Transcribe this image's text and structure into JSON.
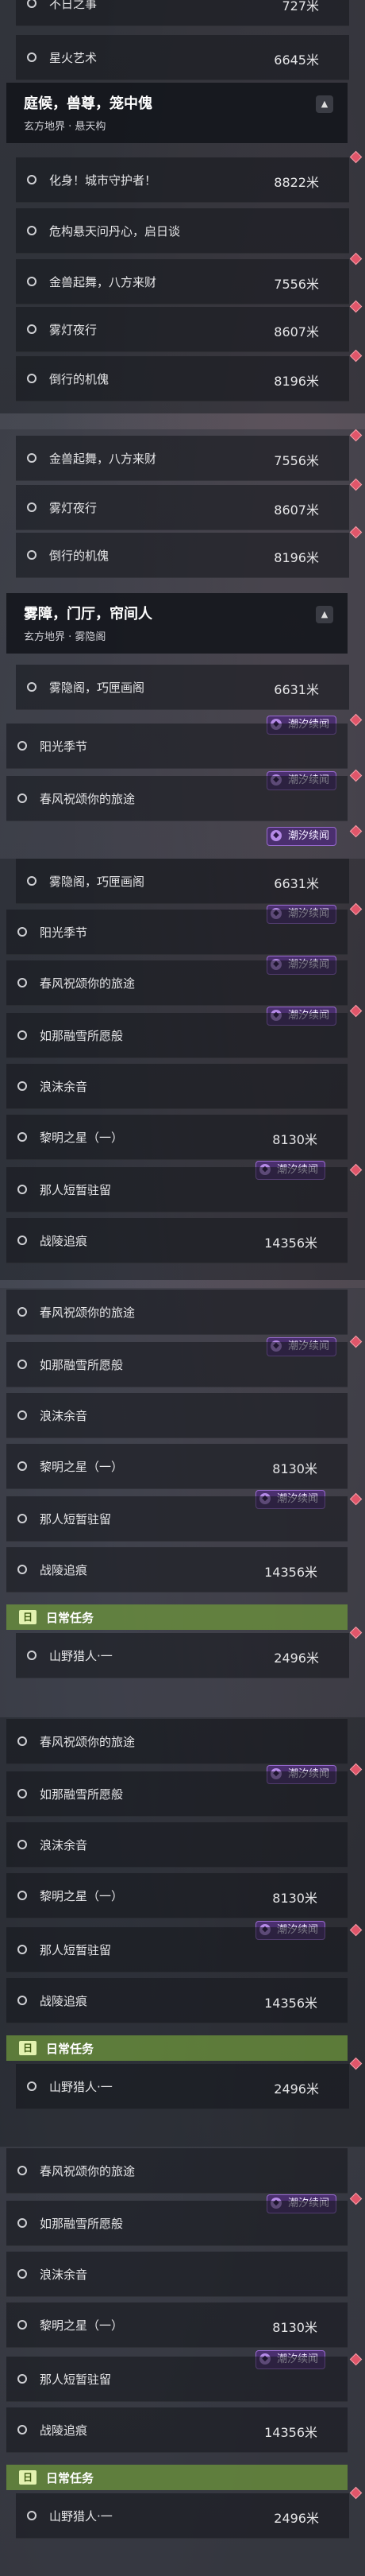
{
  "quests": {
    "q_top": "不日之事",
    "q_starfire": "星火艺术",
    "q_hero": "化身！城市守护者！",
    "q_crisis": "危构悬天问丹心，启日谈",
    "q_beast": "金兽起舞，八方来财",
    "q_fog": "雾灯夜行",
    "q_puppet": "倒行的机傀",
    "q_mist": "雾隐阁，巧匣画阁",
    "q_sun": "阳光季节",
    "q_spring": "春风祝颂你的旅途",
    "q_snow": "如那融雪所愿般",
    "q_foam": "浪沫余音",
    "q_dawn": "黎明之星（一）",
    "q_stay": "那人短暂驻留",
    "q_trace": "战陵追痕",
    "q_hunter": "山野猎人·一"
  },
  "distances": {
    "d_top": "727米",
    "d_starfire": "6645米",
    "d_hero": "8822米",
    "d_beast": "7556米",
    "d_fog": "8607米",
    "d_puppet": "8196米",
    "d_mist": "6631米",
    "d_dawn": "8130米",
    "d_trace": "14356米",
    "d_hunter": "2496米"
  },
  "headers": {
    "h1_title": "庭候，兽尊，笼中傀",
    "h1_sub": "玄方地界 · 悬天构",
    "h2_title": "雾障，门厅，帘间人",
    "h2_sub": "玄方地界 · 雾隐阁"
  },
  "tags": {
    "tide": "潮汐续闻"
  },
  "daily": {
    "label": "日常任务",
    "badge": "日"
  },
  "icons": {
    "tag_icon": "tide-icon",
    "collapse": "chevron-up-icon",
    "status": "diamond-marker-icon",
    "circle": "circle-icon"
  },
  "colors": {
    "tag_bg": "#4a2f6e",
    "daily_bg": "#6e963c",
    "marker": "#e0566a"
  }
}
